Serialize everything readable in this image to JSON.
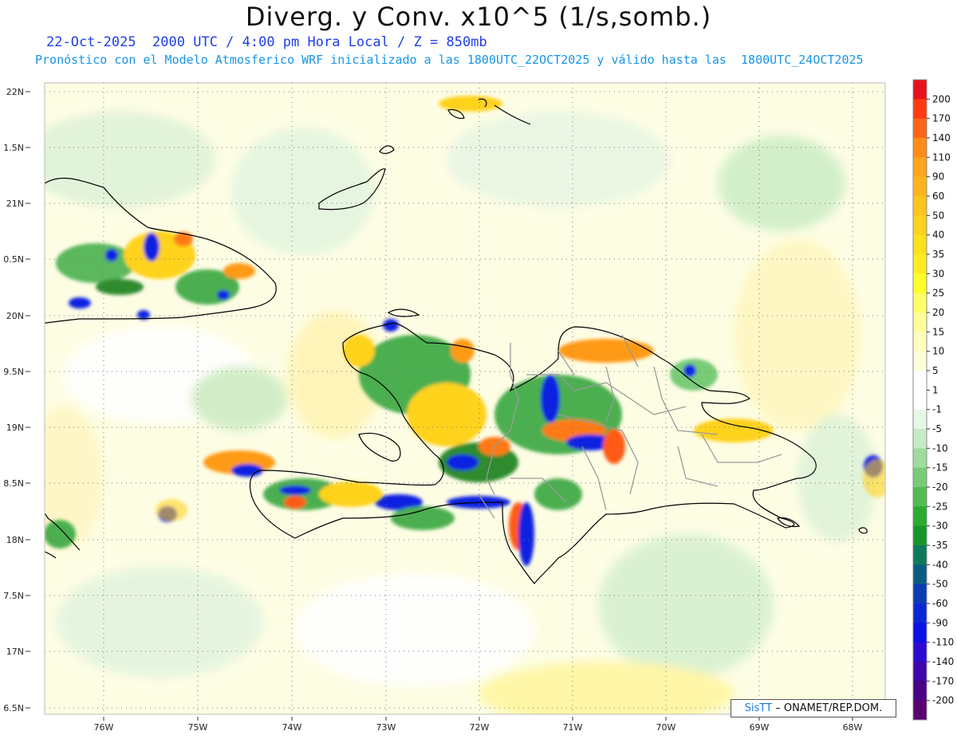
{
  "header": {
    "title": "Diverg. y Conv. x10^5 (1/s,somb.)",
    "subtitle_time": "22-Oct-2025  2000 UTC / 4:00 pm Hora Local / Z = 850mb",
    "subtitle_model": "Pronóstico con el Modelo Atmosferico WRF inicializado a las 1800UTC_22OCT2025 y válido hasta las  1800UTC_24OCT2025"
  },
  "map": {
    "lat_labels": [
      "22N",
      "1.5N",
      "21N",
      "0.5N",
      "20N",
      "9.5N",
      "19N",
      "8.5N",
      "18N",
      "7.5N",
      "17N",
      "6.5N"
    ],
    "lon_labels": [
      "76W",
      "75W",
      "74W",
      "73W",
      "72W",
      "71W",
      "70W",
      "69W",
      "68W"
    ],
    "lat_range": [
      16.5,
      22.0
    ],
    "lon_range": [
      -76.6,
      -67.7
    ],
    "grid": true
  },
  "colorbar": {
    "labels": [
      "200",
      "170",
      "140",
      "110",
      "90",
      "60",
      "50",
      "40",
      "35",
      "30",
      "25",
      "20",
      "15",
      "10",
      "5",
      "1",
      "-1",
      "-5",
      "-10",
      "-15",
      "-20",
      "-25",
      "-30",
      "-35",
      "-40",
      "-50",
      "-60",
      "-90",
      "-110",
      "-140",
      "-170",
      "-200"
    ],
    "colors": [
      "#e8101a",
      "#ff3a12",
      "#ff6414",
      "#ff8c18",
      "#ffa41c",
      "#ffb41e",
      "#ffc41e",
      "#ffd21e",
      "#ffe01e",
      "#ffec22",
      "#ffff2a",
      "#ffff66",
      "#ffff9a",
      "#ffffc0",
      "#ffffdc",
      "#ffffff",
      "#ffffff",
      "#e6f7e6",
      "#c6ecc6",
      "#9edc9e",
      "#78cc78",
      "#52bb52",
      "#2eaa2e",
      "#18962a",
      "#0f7a5a",
      "#0a5c82",
      "#0a3cb4",
      "#0a28d2",
      "#0a10e6",
      "#2d0ad2",
      "#3f06aa",
      "#4a0382",
      "#5a0070"
    ]
  },
  "credit": {
    "brand": "SisTT",
    "org": "– ONAMET/REP.DOM."
  }
}
